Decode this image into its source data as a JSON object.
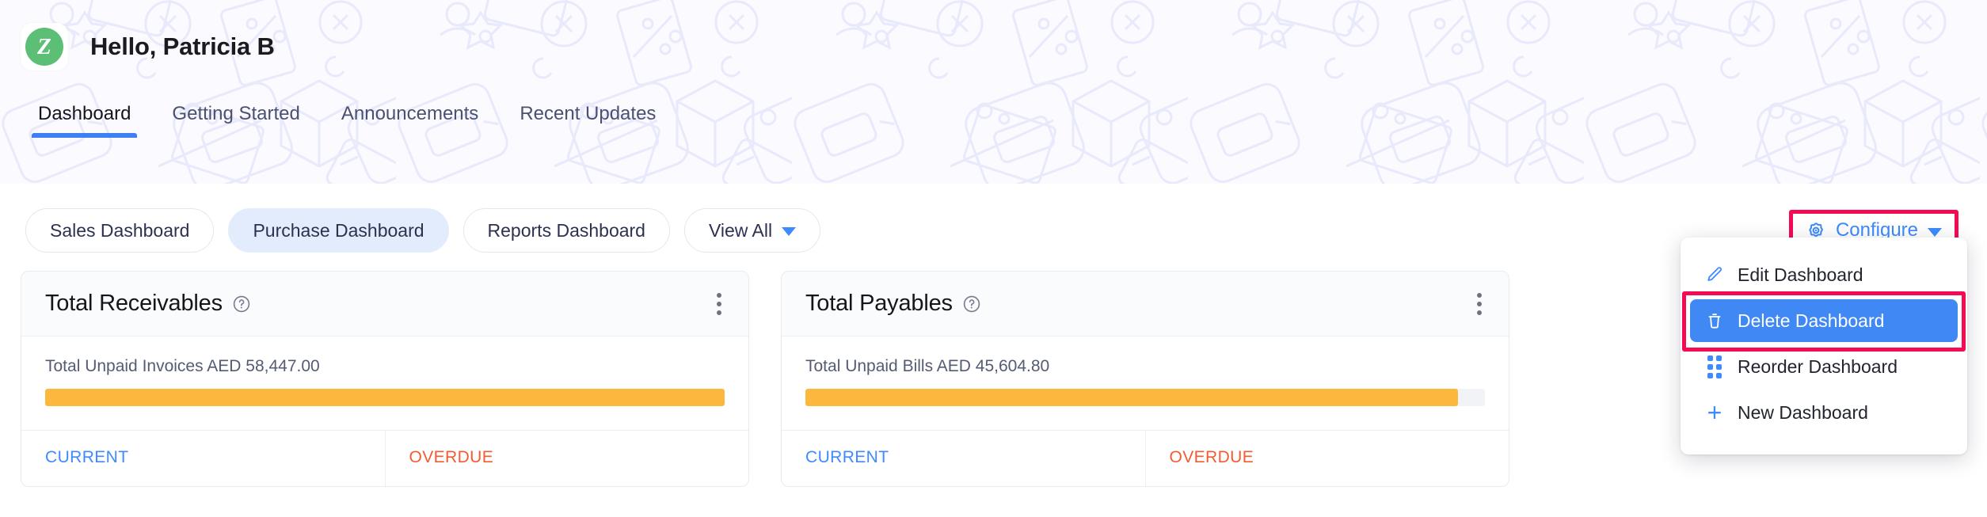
{
  "header": {
    "avatar_letter": "Z",
    "avatar_icon": "zoho-logo-icon",
    "greeting": "Hello, Patricia B"
  },
  "tabs": [
    {
      "label": "Dashboard",
      "active": true
    },
    {
      "label": "Getting Started",
      "active": false
    },
    {
      "label": "Announcements",
      "active": false
    },
    {
      "label": "Recent Updates",
      "active": false
    }
  ],
  "dashboard_pills": [
    {
      "label": "Sales Dashboard",
      "selected": false
    },
    {
      "label": "Purchase Dashboard",
      "selected": true
    },
    {
      "label": "Reports Dashboard",
      "selected": false
    }
  ],
  "view_all": {
    "label": "View All",
    "icon": "chevron-down-icon"
  },
  "configure": {
    "label": "Configure",
    "gear_icon": "gear-icon",
    "chevron_icon": "chevron-down-icon",
    "highlight_color": "#f50a54",
    "accent_color": "#3d8bfd"
  },
  "configure_menu": {
    "items": [
      {
        "label": "Edit Dashboard",
        "icon": "pencil-icon",
        "highlighted": false
      },
      {
        "label": "Delete Dashboard",
        "icon": "trash-icon",
        "highlighted": true
      },
      {
        "label": "Reorder Dashboard",
        "icon": "drag-handle-icon",
        "highlighted": false
      },
      {
        "label": "New Dashboard",
        "icon": "plus-icon",
        "highlighted": false
      }
    ],
    "highlight_bg": "#4089f5"
  },
  "cards": [
    {
      "title": "Total Receivables",
      "help_icon": "help-circle-icon",
      "menu_icon": "kebab-menu-icon",
      "unpaid_label": "Total Unpaid Invoices AED 58,447.00",
      "bar_percent": 100,
      "bar_color": "#fcb73e",
      "foot_current": "CURRENT",
      "foot_overdue": "OVERDUE"
    },
    {
      "title": "Total Payables",
      "help_icon": "help-circle-icon",
      "menu_icon": "kebab-menu-icon",
      "unpaid_label": "Total Unpaid Bills AED 45,604.80",
      "bar_percent": 96,
      "bar_color": "#fcb73e",
      "foot_current": "CURRENT",
      "foot_overdue": "OVERDUE"
    }
  ]
}
